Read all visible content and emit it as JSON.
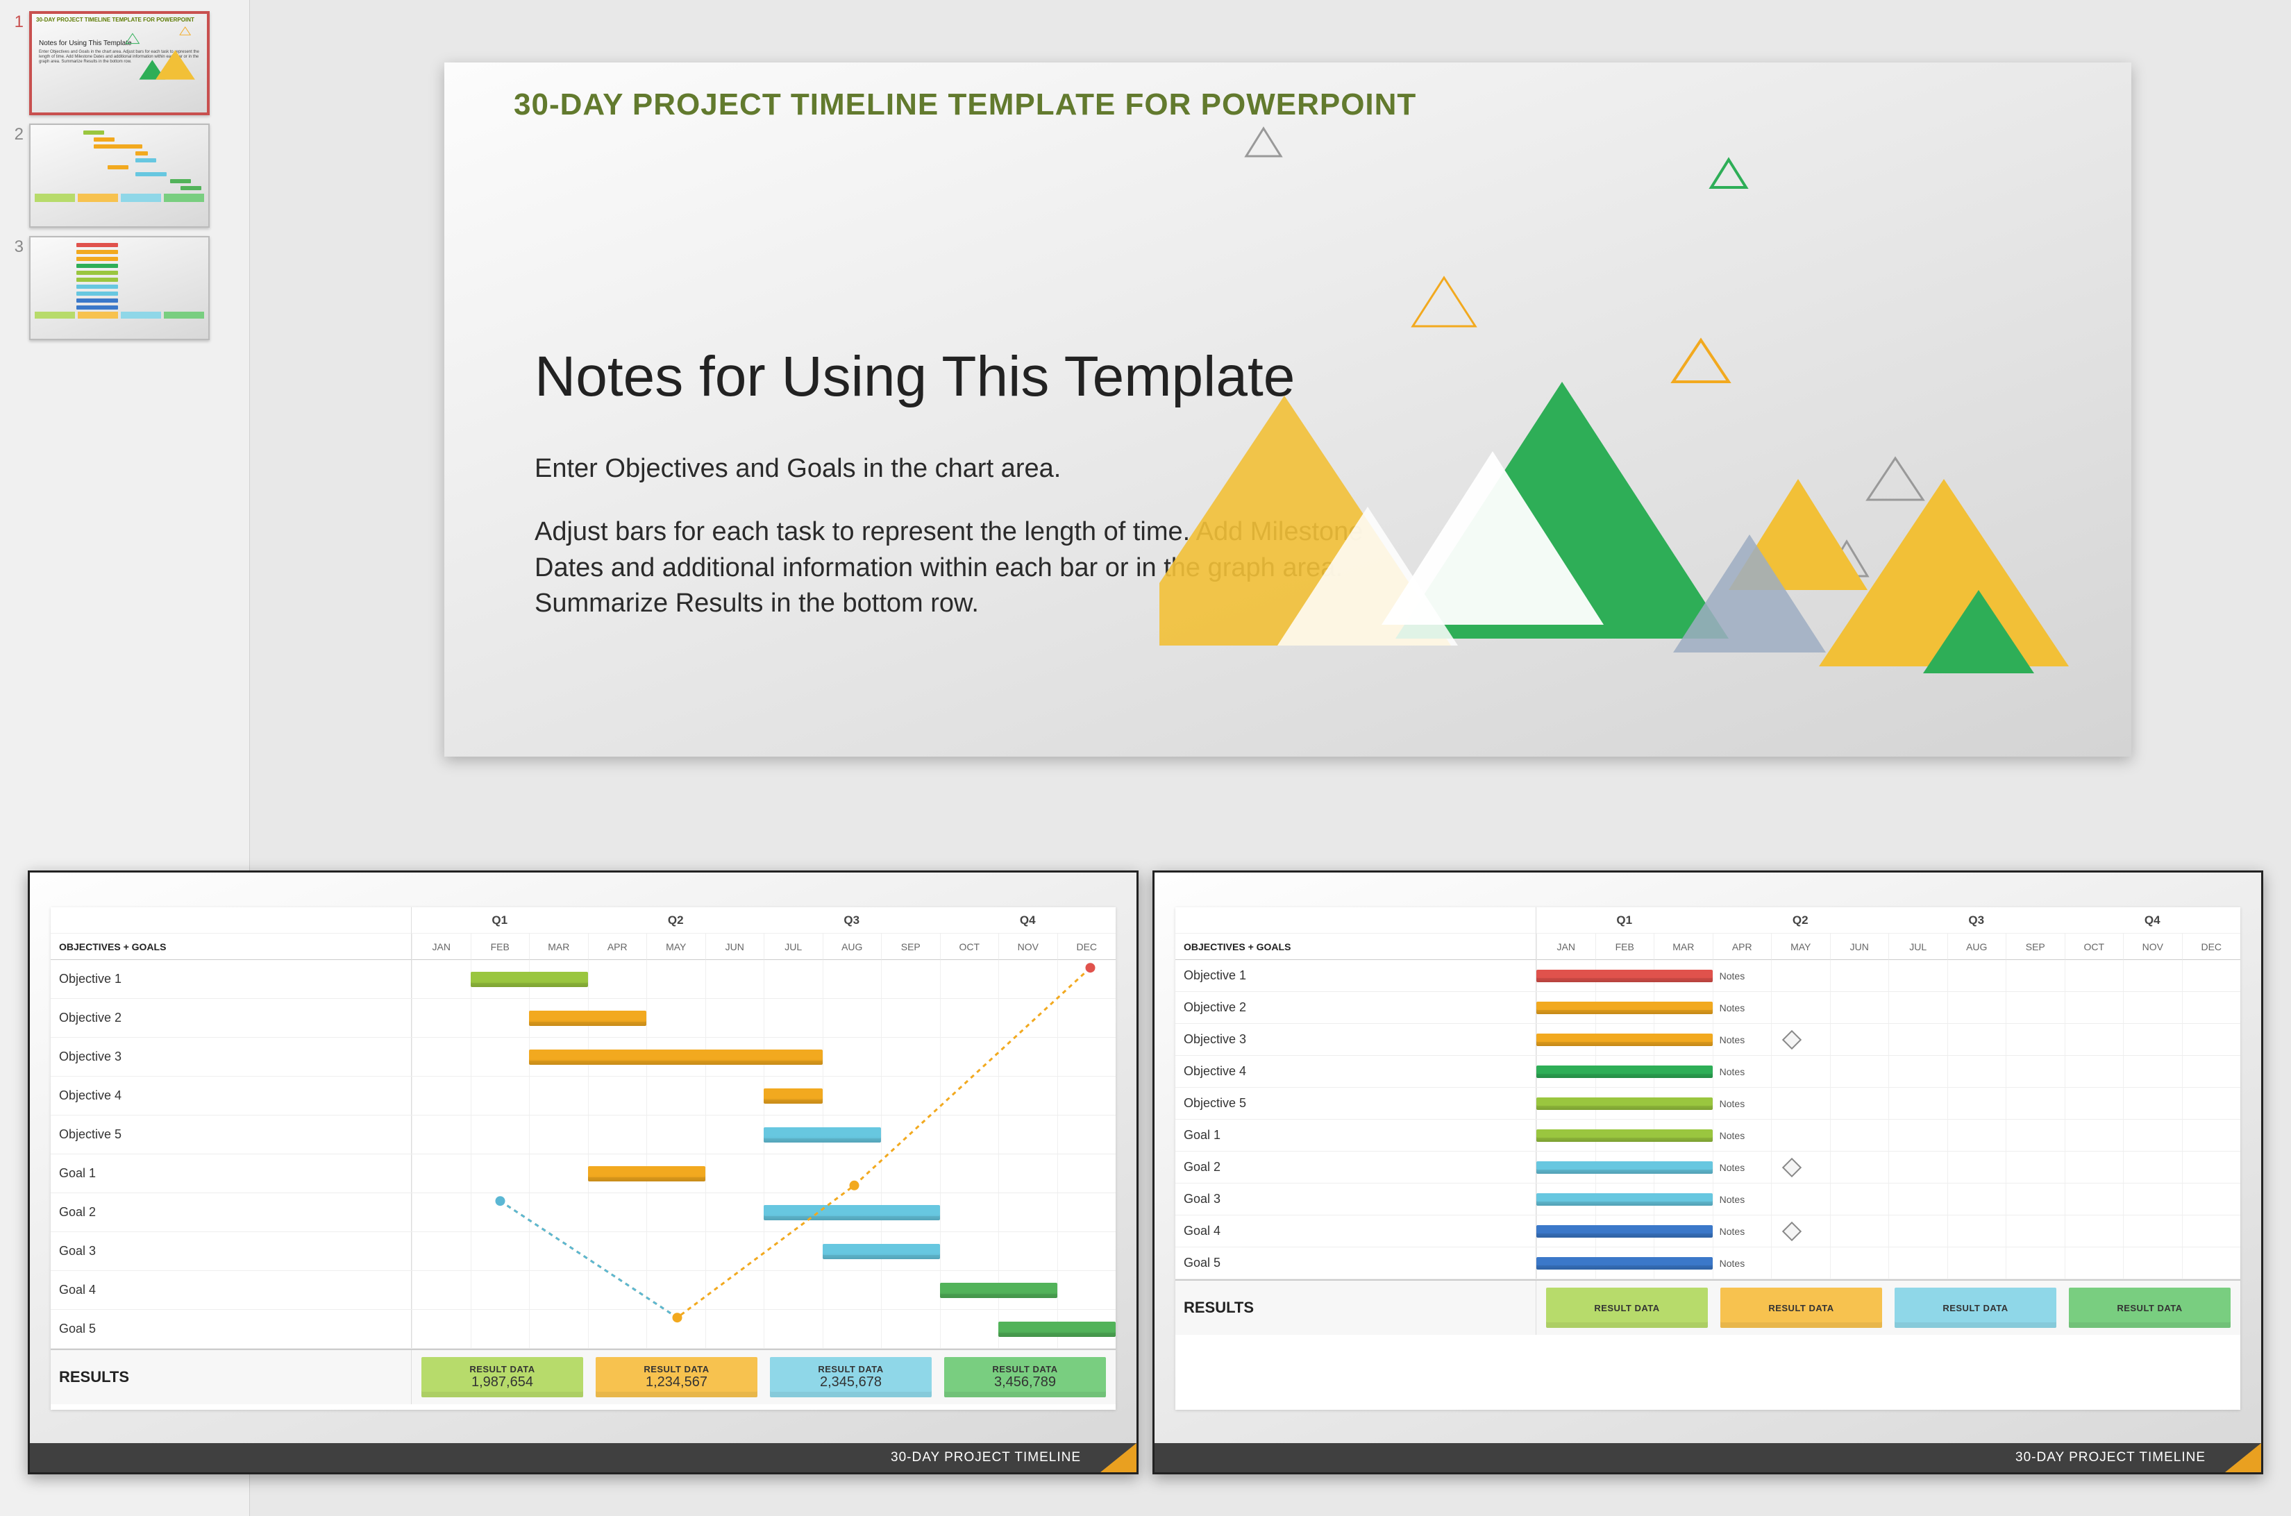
{
  "thumbnails": [
    {
      "num": "1",
      "active": true
    },
    {
      "num": "2",
      "active": false
    },
    {
      "num": "3",
      "active": false
    }
  ],
  "slide": {
    "header": "30-DAY PROJECT TIMELINE TEMPLATE FOR POWERPOINT",
    "title": "Notes for Using This Template",
    "p1": "Enter Objectives and Goals in the chart area.",
    "p2": "Adjust bars for each task to represent the length of time.  Add Milestone Dates and additional information within each bar or in the graph area. Summarize Results in the bottom row."
  },
  "gantt_common": {
    "objectives_label": "OBJECTIVES + GOALS",
    "quarters": [
      "Q1",
      "Q2",
      "Q3",
      "Q4"
    ],
    "months": [
      "JAN",
      "FEB",
      "MAR",
      "APR",
      "MAY",
      "JUN",
      "JUL",
      "AUG",
      "SEP",
      "OCT",
      "NOV",
      "DEC"
    ],
    "results_label": "RESULTS",
    "footer": "30-DAY PROJECT TIMELINE"
  },
  "gantt_left": {
    "rows": [
      {
        "label": "Objective 1",
        "bar": {
          "start": 1,
          "span": 2,
          "color": "#9ac63f"
        }
      },
      {
        "label": "Objective 2",
        "bar": {
          "start": 2,
          "span": 2,
          "color": "#f2a91f"
        }
      },
      {
        "label": "Objective 3",
        "bar": {
          "start": 2,
          "span": 5,
          "color": "#f2a91f"
        }
      },
      {
        "label": "Objective 4",
        "bar": {
          "start": 6,
          "span": 1,
          "color": "#f2a91f"
        }
      },
      {
        "label": "Objective 5",
        "bar": {
          "start": 6,
          "span": 2,
          "color": "#67c7e0"
        }
      },
      {
        "label": "Goal 1",
        "bar": {
          "start": 3,
          "span": 2,
          "color": "#f2a91f"
        }
      },
      {
        "label": "Goal 2",
        "bar": {
          "start": 6,
          "span": 3,
          "color": "#67c7e0"
        }
      },
      {
        "label": "Goal 3",
        "bar": {
          "start": 7,
          "span": 2,
          "color": "#67c7e0"
        }
      },
      {
        "label": "Goal 4",
        "bar": {
          "start": 9,
          "span": 2,
          "color": "#52b35a"
        }
      },
      {
        "label": "Goal 5",
        "bar": {
          "start": 10,
          "span": 2,
          "color": "#52b35a"
        }
      }
    ],
    "results": [
      {
        "top": "RESULT DATA",
        "bot": "1,987,654",
        "color": "#b7db6b"
      },
      {
        "top": "RESULT DATA",
        "bot": "1,234,567",
        "color": "#f7c24f"
      },
      {
        "top": "RESULT DATA",
        "bot": "2,345,678",
        "color": "#8fd7e8"
      },
      {
        "top": "RESULT DATA",
        "bot": "3,456,789",
        "color": "#79ce80"
      }
    ],
    "line_points": [
      {
        "x": 1.5,
        "y": 6.2,
        "color": "#5bb7d4"
      },
      {
        "x": 4.5,
        "y": 9.2,
        "color": "#f2a91f"
      },
      {
        "x": 7.5,
        "y": 5.8,
        "color": "#f2a91f"
      },
      {
        "x": 11.5,
        "y": 0.2,
        "color": "#e0524c"
      }
    ]
  },
  "gantt_right": {
    "rows": [
      {
        "label": "Objective 1",
        "color": "#e0524c",
        "notes": "Notes",
        "diamond": false
      },
      {
        "label": "Objective 2",
        "color": "#f2a91f",
        "notes": "Notes",
        "diamond": false
      },
      {
        "label": "Objective 3",
        "color": "#f2a91f",
        "notes": "Notes",
        "diamond": true
      },
      {
        "label": "Objective 4",
        "color": "#2eae57",
        "notes": "Notes",
        "diamond": false
      },
      {
        "label": "Objective 5",
        "color": "#9ac63f",
        "notes": "Notes",
        "diamond": false
      },
      {
        "label": "Goal 1",
        "color": "#9ac63f",
        "notes": "Notes",
        "diamond": false
      },
      {
        "label": "Goal 2",
        "color": "#67c7e0",
        "notes": "Notes",
        "diamond": true
      },
      {
        "label": "Goal 3",
        "color": "#67c7e0",
        "notes": "Notes",
        "diamond": false
      },
      {
        "label": "Goal 4",
        "color": "#3b78c9",
        "notes": "Notes",
        "diamond": true
      },
      {
        "label": "Goal 5",
        "color": "#3b78c9",
        "notes": "Notes",
        "diamond": false
      }
    ],
    "results": [
      {
        "top": "RESULT DATA",
        "bot": "",
        "color": "#b7db6b"
      },
      {
        "top": "RESULT DATA",
        "bot": "",
        "color": "#f7c24f"
      },
      {
        "top": "RESULT DATA",
        "bot": "",
        "color": "#8fd7e8"
      },
      {
        "top": "RESULT DATA",
        "bot": "",
        "color": "#79ce80"
      }
    ]
  },
  "colors": {
    "green": "#2eae57",
    "lime": "#9ac63f",
    "orange": "#f2a91f",
    "yellow": "#f2c037",
    "blue": "#3b78c9",
    "cyan": "#67c7e0",
    "red": "#e0524c",
    "gray": "#9aa3b0"
  }
}
